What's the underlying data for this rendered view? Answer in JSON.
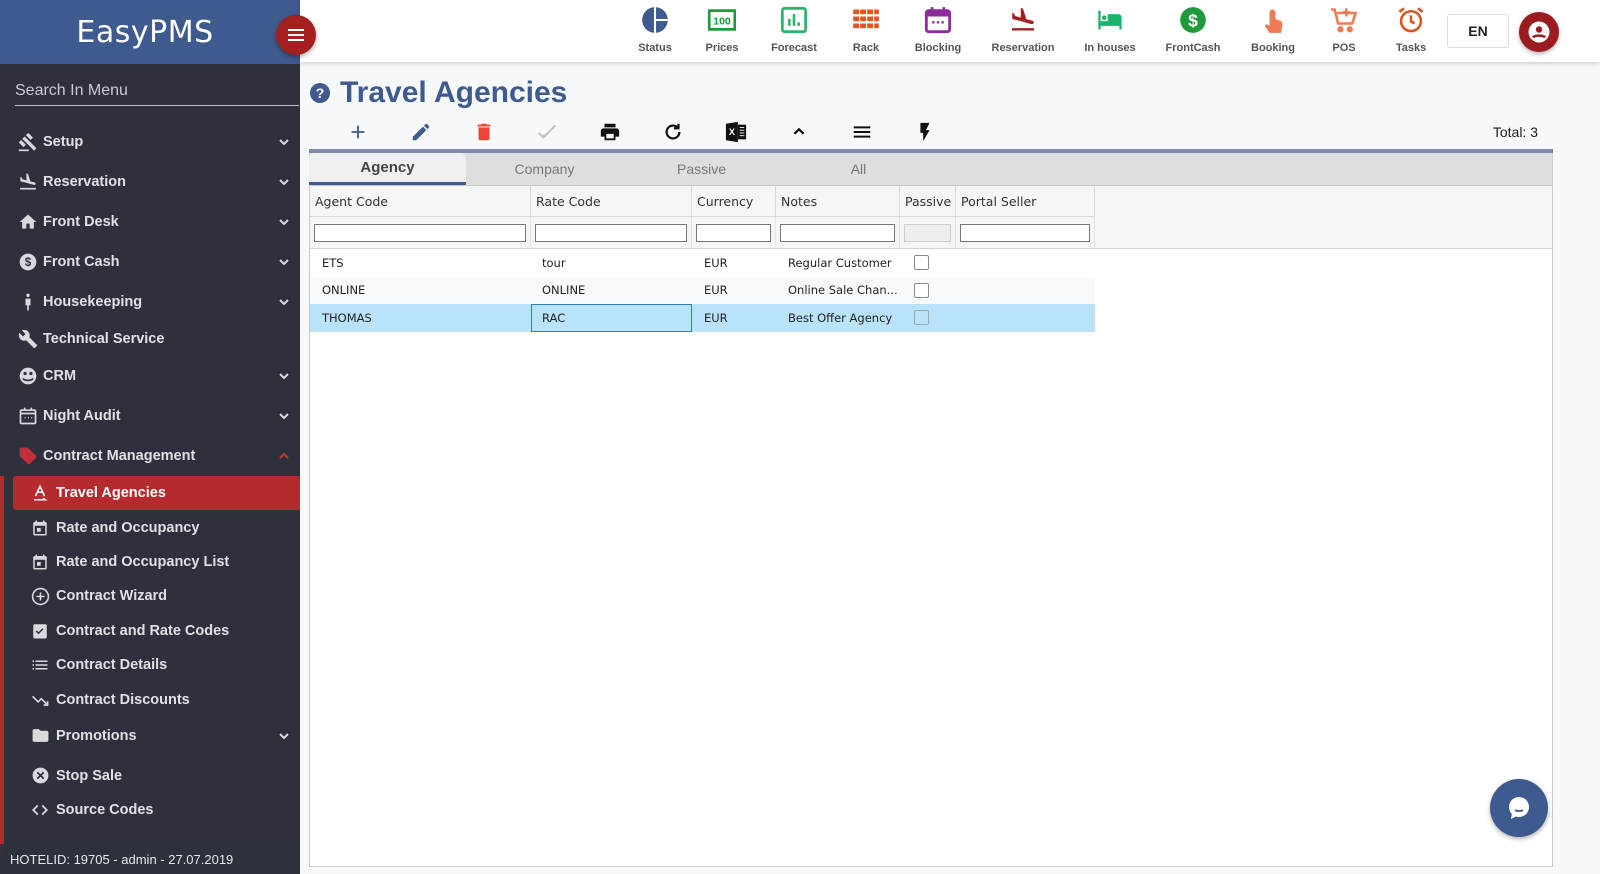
{
  "app": {
    "brand": "EasyPMS"
  },
  "sidebar": {
    "search_placeholder": "Search In Menu",
    "items": [
      {
        "label": "Setup",
        "icon": "gavel-icon",
        "expandable": true
      },
      {
        "label": "Reservation",
        "icon": "flight-land-icon",
        "expandable": true
      },
      {
        "label": "Front Desk",
        "icon": "home-icon",
        "expandable": true
      },
      {
        "label": "Front Cash",
        "icon": "dollar-circle-icon",
        "expandable": true
      },
      {
        "label": "Housekeeping",
        "icon": "person-icon",
        "expandable": true
      },
      {
        "label": "Technical Service",
        "icon": "wrench-icon",
        "expandable": false
      },
      {
        "label": "CRM",
        "icon": "crm-icon",
        "expandable": true
      },
      {
        "label": "Night Audit",
        "icon": "calendar-icon",
        "expandable": true
      },
      {
        "label": "Contract Management",
        "icon": "tag-icon",
        "expandable": true,
        "open": true
      }
    ],
    "sub_items": [
      {
        "label": "Travel Agencies",
        "icon": "agency-icon",
        "active": true
      },
      {
        "label": "Rate and Occupancy",
        "icon": "calendar-day-icon"
      },
      {
        "label": "Rate and Occupancy List",
        "icon": "calendar-day-icon"
      },
      {
        "label": "Contract Wizard",
        "icon": "plus-circle-icon"
      },
      {
        "label": "Contract and Rate Codes",
        "icon": "clipboard-check-icon"
      },
      {
        "label": "Contract Details",
        "icon": "list-icon"
      },
      {
        "label": "Contract Discounts",
        "icon": "trending-down-icon"
      },
      {
        "label": "Promotions",
        "icon": "folder-icon",
        "expandable": true
      },
      {
        "label": "Stop Sale",
        "icon": "cancel-circle-icon"
      },
      {
        "label": "Source Codes",
        "icon": "code-icon"
      }
    ],
    "footer": "HOTELID: 19705 - admin - 27.07.2019"
  },
  "topbar": {
    "actions": [
      {
        "label": "Status",
        "icon": "pie-icon",
        "color": "#3f5a8f"
      },
      {
        "label": "Prices",
        "icon": "prices-icon",
        "color": "#1f9a3a"
      },
      {
        "label": "Forecast",
        "icon": "chart-icon",
        "color": "#2db36b"
      },
      {
        "label": "Rack",
        "icon": "grid-icon",
        "color": "#e0561f"
      },
      {
        "label": "Blocking",
        "icon": "calendar-icon",
        "color": "#8e2b9c"
      },
      {
        "label": "Reservation",
        "icon": "flight-land-icon",
        "color": "#a41f1f"
      },
      {
        "label": "In houses",
        "icon": "bed-icon",
        "color": "#1db36b"
      },
      {
        "label": "FrontCash",
        "icon": "dollar-circle-icon",
        "color": "#1f9a3a"
      },
      {
        "label": "Booking",
        "icon": "touch-icon",
        "color": "#ef7a55"
      },
      {
        "label": "POS",
        "icon": "cart-icon",
        "color": "#ef7a55"
      },
      {
        "label": "Tasks",
        "icon": "alarm-icon",
        "color": "#d9541e"
      }
    ],
    "language": "EN"
  },
  "page": {
    "title": "Travel Agencies",
    "total_label": "Total: 3",
    "toolbar": [
      "add",
      "edit",
      "delete",
      "approve",
      "print",
      "refresh",
      "excel",
      "collapse",
      "menu",
      "flash"
    ],
    "tabs": [
      {
        "label": "Agency",
        "active": true
      },
      {
        "label": "Company"
      },
      {
        "label": "Passive"
      },
      {
        "label": "All"
      }
    ]
  },
  "grid": {
    "columns": [
      "Agent Code",
      "Rate Code",
      "Currency",
      "Notes",
      "Passive",
      "Portal Seller"
    ],
    "rows": [
      {
        "agent_code": "ETS",
        "rate_code": "tour",
        "currency": "EUR",
        "notes": "Regular Customer",
        "passive": false,
        "portal_seller": ""
      },
      {
        "agent_code": "ONLINE",
        "rate_code": "ONLINE",
        "currency": "EUR",
        "notes": "Online Sale Chan...",
        "passive": false,
        "portal_seller": ""
      },
      {
        "agent_code": "THOMAS",
        "rate_code": "RAC",
        "currency": "EUR",
        "notes": "Best Offer Agency",
        "passive": false,
        "portal_seller": "",
        "selected": true
      }
    ]
  }
}
